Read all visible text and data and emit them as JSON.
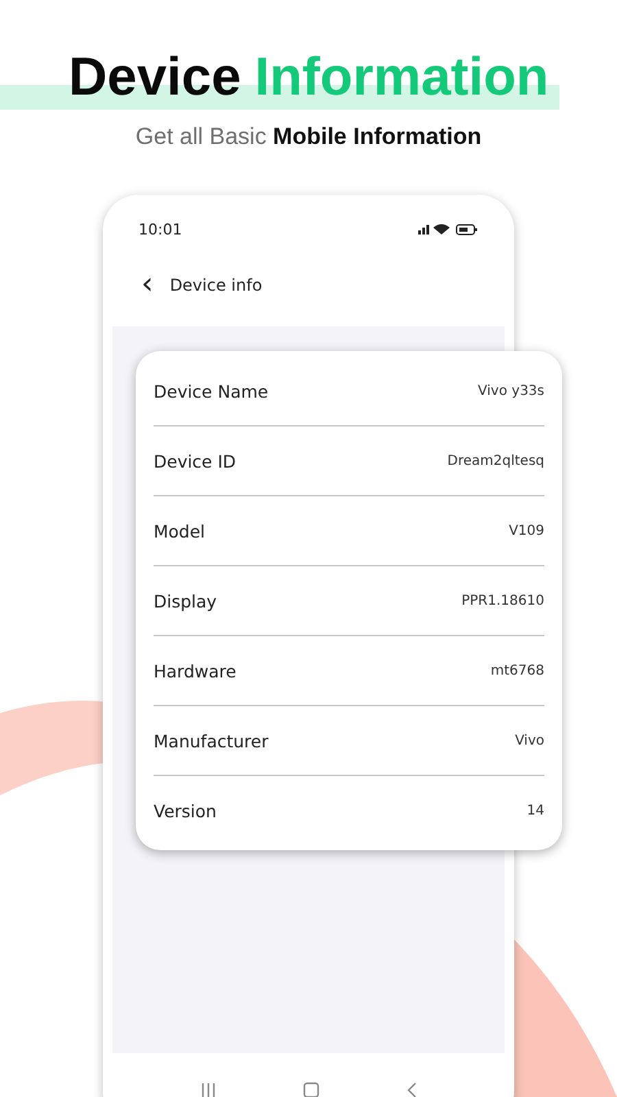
{
  "headline": {
    "lead": "Device",
    "accent": "Information"
  },
  "subtitle": "Get all Basic **Mobile Information**",
  "status_bar": {
    "time": "10:01"
  },
  "header": {
    "back": "‹",
    "title": "Device info"
  },
  "info_rows": [
    {
      "label": "Device Name",
      "value": "Vivo y33s"
    },
    {
      "label": "Device ID",
      "value": "Dream2qltesq"
    },
    {
      "label": "Model",
      "value": "V109"
    },
    {
      "label": "Display",
      "value": "PPR1.18610"
    },
    {
      "label": "Hardware",
      "value": "mt6768"
    },
    {
      "label": "Manufacturer",
      "value": "Vivo"
    },
    {
      "label": "Version",
      "value": "14"
    }
  ]
}
